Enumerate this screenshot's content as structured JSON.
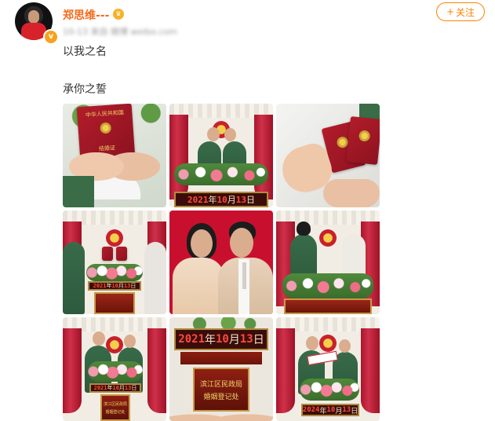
{
  "post": {
    "author": "郑思维---",
    "meta_blurred": "10-13 来自 微博 weibo.com",
    "follow_label": "关注",
    "follow_icon": "plus-icon",
    "lines": [
      "以我之名",
      "承你之誓"
    ]
  },
  "photos": {
    "cert_title": "结婚证",
    "cert_header": "中华人民共和国",
    "led_year": "2021",
    "led_month": "10",
    "led_day": "13",
    "led_year_b": "2024",
    "unit_year": "年",
    "unit_month": "月",
    "unit_day": "日",
    "plaque_line1": "滨江区民政局",
    "plaque_line2": "婚姻登记处"
  },
  "colors": {
    "author": "#f56b1d",
    "follow": "#ff8200",
    "curtain": "#c0223a",
    "uniform": "#386b4a"
  }
}
